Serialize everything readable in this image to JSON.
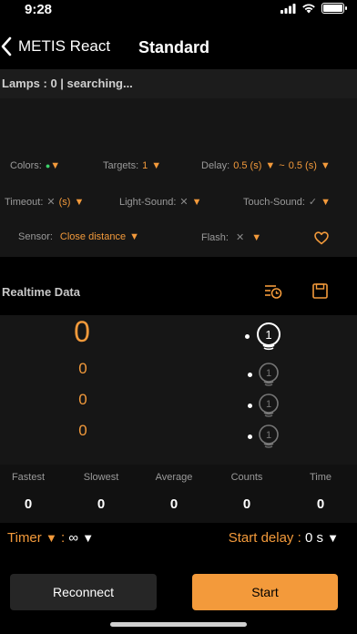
{
  "status_bar": {
    "time": "9:28",
    "battery_level": 1.0
  },
  "nav": {
    "back_label": "METIS React",
    "title": "Standard"
  },
  "lamps_status": "Lamps : 0 | searching...",
  "settings": {
    "colors": {
      "label": "Colors:"
    },
    "targets": {
      "label": "Targets:",
      "value": "1"
    },
    "delay": {
      "label": "Delay:",
      "value": "0.5 (s)",
      "separator": "~",
      "value2": "0.5 (s)"
    },
    "timeout": {
      "label": "Timeout:",
      "unit": "(s)"
    },
    "light_sound": {
      "label": "Light-Sound:"
    },
    "touch_sound": {
      "label": "Touch-Sound:"
    },
    "sensor": {
      "label": "Sensor:",
      "value": "Close distance"
    },
    "flash": {
      "label": "Flash:"
    }
  },
  "realtime": {
    "title": "Realtime Data",
    "values": [
      "0",
      "0",
      "0",
      "0"
    ],
    "lamp_numbers": [
      "1",
      "1",
      "1",
      "1"
    ]
  },
  "stats": [
    {
      "label": "Fastest",
      "value": "0"
    },
    {
      "label": "Slowest",
      "value": "0"
    },
    {
      "label": "Average",
      "value": "0"
    },
    {
      "label": "Counts",
      "value": "0"
    },
    {
      "label": "Time",
      "value": "0"
    }
  ],
  "timer": {
    "label": "Timer",
    "colon": ":",
    "value": "∞"
  },
  "start_delay": {
    "label": "Start delay :",
    "value": "0 s"
  },
  "buttons": {
    "reconnect": "Reconnect",
    "start": "Start"
  },
  "colors_map": {
    "accent": "#f39a3b",
    "green": "#3dd36b",
    "panel": "#161616"
  }
}
